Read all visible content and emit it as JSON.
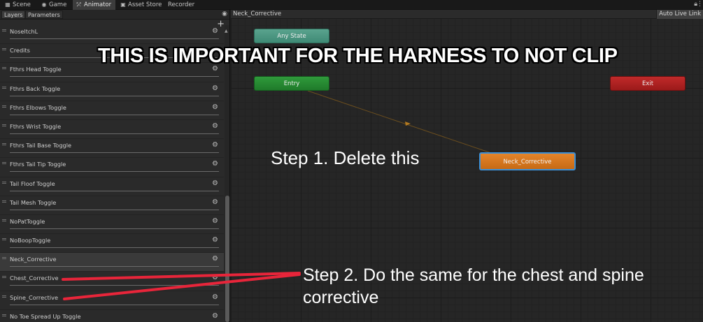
{
  "editor_tabs": [
    {
      "label": "Scene",
      "icon": "scene-icon"
    },
    {
      "label": "Game",
      "icon": "game-icon"
    },
    {
      "label": "Animator",
      "icon": "animator-icon"
    },
    {
      "label": "Asset Store",
      "icon": "asset-store-icon"
    },
    {
      "label": "Recorder",
      "icon": ""
    }
  ],
  "active_tab": "Animator",
  "left_panel": {
    "tabs": {
      "layers": "Layers",
      "parameters": "Parameters"
    },
    "add_button": "+",
    "parameters": [
      {
        "name": "NoseltchL"
      },
      {
        "name": "Credits"
      },
      {
        "name": "Fthrs Head Toggle"
      },
      {
        "name": "Fthrs Back Toggle"
      },
      {
        "name": "Fthrs Elbows Toggle"
      },
      {
        "name": "Fthrs Wrist Toggle"
      },
      {
        "name": "Fthrs Tail Base Toggle"
      },
      {
        "name": "Fthrs Tail Tip Toggle"
      },
      {
        "name": "Tail Floof Toggle"
      },
      {
        "name": "Tail Mesh Toggle"
      },
      {
        "name": "NoPatToggle"
      },
      {
        "name": "NoBoopToggle"
      },
      {
        "name": "Neck_Corrective",
        "selected": true
      },
      {
        "name": "Chest_Corrective"
      },
      {
        "name": "Spine_Corrective"
      },
      {
        "name": "No Toe Spread Up Toggle"
      }
    ]
  },
  "graph": {
    "breadcrumb": "Neck_Corrective",
    "auto_live_link": "Auto Live Link",
    "states": {
      "any_state": "Any State",
      "entry": "Entry",
      "exit": "Exit",
      "neck_corrective": "Neck_Corrective"
    }
  },
  "annotations": {
    "important": "THIS IS IMPORTANT FOR THE HARNESS TO NOT CLIP",
    "step1": "Step 1. Delete this",
    "step2": "Step 2. Do the same for the chest and spine corrective"
  },
  "colors": {
    "any_state": "#4a9a84",
    "entry": "#278a33",
    "exit": "#b02222",
    "default_state": "#d97a1f",
    "selection_outline": "#3b8fd6",
    "annotation_arrow": "#e8253a"
  }
}
